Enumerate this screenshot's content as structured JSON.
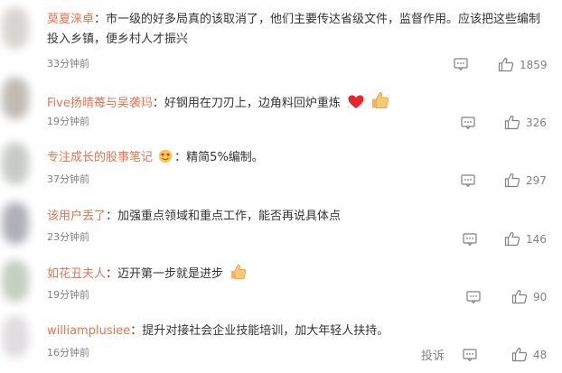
{
  "comments": [
    {
      "username": "莫夏涞卓",
      "separator": "：",
      "text": "市一级的好多局真的该取消了，他们主要传达省级文件，监督作用。应该把这些编制投入乡镇，便乡村人才振兴",
      "time": "33分钟前",
      "likes": "1859"
    },
    {
      "username": "Five扬晴苺与吴袭玛",
      "separator": "：",
      "text": "好钢用在刀刃上，边角料回炉重炼",
      "emojis": [
        "red-heart-emoji",
        "thumbs-up-emoji"
      ],
      "time": "19分钟前",
      "likes": "326"
    },
    {
      "username": "专注成长的股事笔记",
      "separator": "：",
      "text": "精简5%编制。",
      "emojis": [
        "heart-eyes-badge-emoji"
      ],
      "time": "37分钟前",
      "likes": "297"
    },
    {
      "username": "该用户丢了",
      "separator": "：",
      "text": "加强重点领域和重点工作，能否再说具体点",
      "time": "23分钟前",
      "likes": "146"
    },
    {
      "username": "如花丑夫人",
      "separator": "：",
      "text": "迈开第一步就是进步",
      "emojis": [
        "thumbs-up-emoji"
      ],
      "time": "19分钟前",
      "likes": "90"
    },
    {
      "username": "williamplusiee",
      "separator": "：",
      "text": "提升对接社会企业技能培训，加大年轻人扶持。",
      "time": "16分钟前",
      "likes": "48",
      "report_label": "投诉"
    }
  ],
  "colors": {
    "username": "#eb7350",
    "text": "#333333",
    "meta": "#808080"
  }
}
